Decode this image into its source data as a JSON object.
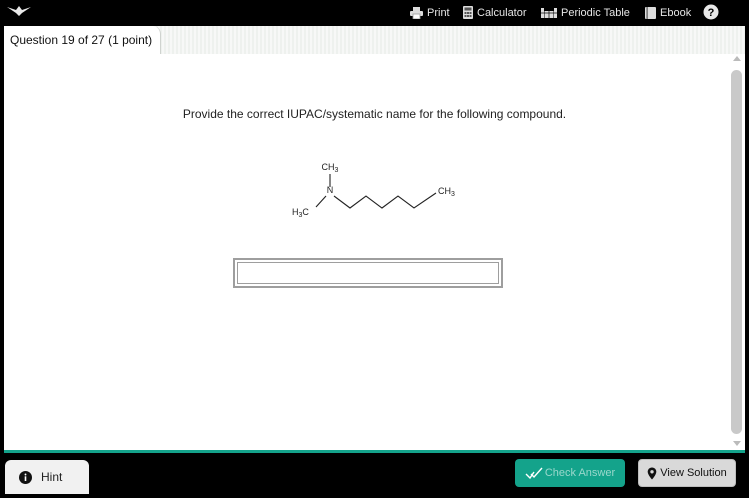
{
  "toolbar": {
    "print_label": "Print",
    "calculator_label": "Calculator",
    "periodic_table_label": "Periodic Table",
    "ebook_label": "Ebook",
    "help_symbol": "?"
  },
  "question": {
    "tab_label": "Question 19 of 27 (1 point)",
    "prompt": "Provide the correct IUPAC/systematic name for the following compound."
  },
  "molecule": {
    "n_label": "N",
    "top_methyl": "CH3",
    "left_methyl": "H3C",
    "chain_end": "CH3"
  },
  "answer": {
    "value": "",
    "placeholder": ""
  },
  "bottom": {
    "hint_label": "Hint",
    "check_label": "Check Answer",
    "view_solution_label": "View Solution"
  },
  "colors": {
    "accent": "#14a38b",
    "topbar": "#000000",
    "content_bg": "#ffffff"
  }
}
